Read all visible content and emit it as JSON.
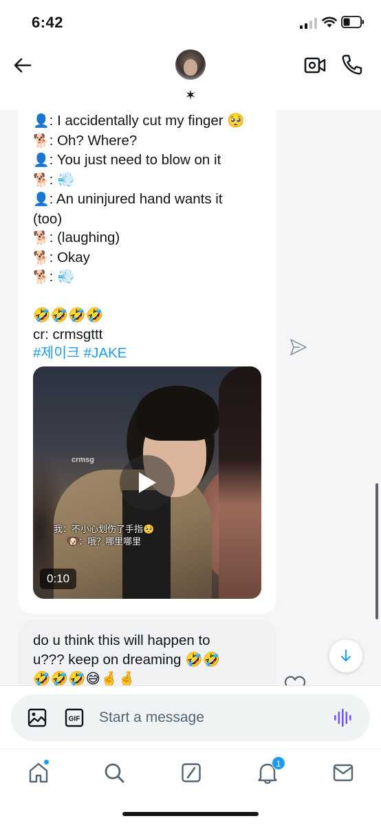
{
  "status_bar": {
    "time": "6:42",
    "icons": [
      "signal-icon",
      "wifi-icon",
      "battery-icon"
    ]
  },
  "header": {
    "back_icon": "arrow-left-icon",
    "contact_name": "✶",
    "video_call_icon": "video-call-icon",
    "phone_call_icon": "phone-icon"
  },
  "messages": [
    {
      "lines": [
        {
          "speaker": "👤",
          "text": ": I accidentally cut my finger 🥺"
        },
        {
          "speaker": "🐕",
          "text": ": Oh? Where?"
        },
        {
          "speaker": "👤",
          "text": ": You just need to blow on it"
        },
        {
          "speaker": "🐕",
          "text": ": 💨"
        },
        {
          "speaker": "👤",
          "text": ": An uninjured hand wants it"
        },
        {
          "speaker": "",
          "text": "(too)"
        },
        {
          "speaker": "🐕",
          "text": ": (laughing)"
        },
        {
          "speaker": "🐕",
          "text": ": Okay"
        },
        {
          "speaker": "🐕",
          "text": ": 💨"
        }
      ],
      "reaction_emojis": "🤣🤣🤣🤣",
      "credit": "cr: crmsgttt",
      "hashtags": [
        "#제이크",
        "#JAKE"
      ],
      "video": {
        "watermark": "crmsg",
        "subtitle_line_1": "我：不小心划伤了手指🥺",
        "subtitle_line_2": "🐶：哦？哪里哪里",
        "duration": "0:10",
        "play_icon": "play-icon"
      },
      "share_icon": "share-icon"
    },
    {
      "text": "do u think this will happen to u??? keep on dreaming 🤣🤣🤣🤣🤣😅🤞🤞",
      "line_1": "do u think this will happen to",
      "line_2": "u??? keep on dreaming 🤣🤣",
      "line_3": "🤣🤣🤣😅🤞🤞",
      "heart_icon": "heart-icon"
    }
  ],
  "scroll_down_icon": "arrow-down-icon",
  "composer": {
    "media_icon": "image-icon",
    "gif_label": "GIF",
    "placeholder": "Start a message",
    "value": "",
    "voice_icon": "voice-wave-icon"
  },
  "tab_bar": {
    "tabs": [
      {
        "name": "home",
        "icon": "home-icon",
        "has_dot": true
      },
      {
        "name": "search",
        "icon": "search-icon"
      },
      {
        "name": "grok",
        "icon": "grok-icon"
      },
      {
        "name": "notifications",
        "icon": "bell-icon",
        "badge": "1"
      },
      {
        "name": "messages",
        "icon": "mail-icon"
      }
    ]
  },
  "colors": {
    "accent": "#1d9bf0",
    "voice": "#7856ff",
    "text": "#0f1419",
    "muted": "#536471",
    "received_bubble": "#ffffff",
    "sent_bubble": "#eff1f3"
  }
}
